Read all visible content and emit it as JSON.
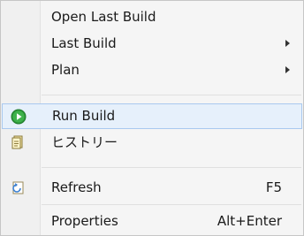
{
  "menu": {
    "items": [
      {
        "label": "Open Last Build"
      },
      {
        "label": "Last Build",
        "has_submenu": true
      },
      {
        "label": "Plan",
        "has_submenu": true
      },
      {
        "label": "Run Build",
        "icon": "run-icon",
        "highlighted": true
      },
      {
        "label": "ヒストリー",
        "icon": "history-icon"
      },
      {
        "label": "Refresh",
        "icon": "refresh-icon",
        "shortcut": "F5"
      },
      {
        "label": "Properties",
        "shortcut": "Alt+Enter"
      }
    ]
  },
  "colors": {
    "highlight_fill": "#e6f0fb",
    "highlight_border": "#a9c9ef",
    "run_icon_green": "#2e9a3a"
  }
}
